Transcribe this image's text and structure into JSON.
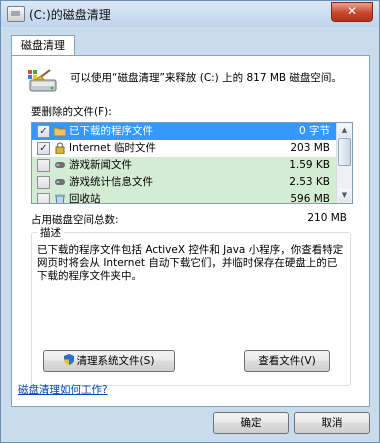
{
  "window": {
    "title": "(C:)的磁盘清理",
    "close_glyph": "✕"
  },
  "tab": {
    "label": "磁盘清理"
  },
  "intro_text": "可以使用“磁盘清理”来释放  (C:) 上的 817 MB 磁盘空间。",
  "files_label": "要删除的文件(F):",
  "files": [
    {
      "name": "已下载的程序文件",
      "size": "0 字节",
      "checked": true,
      "icon": "folder-icon"
    },
    {
      "name": "Internet 临时文件",
      "size": "203 MB",
      "checked": true,
      "icon": "lock-icon"
    },
    {
      "name": "游戏新闻文件",
      "size": "1.59 KB",
      "checked": false,
      "icon": "gamepad-icon"
    },
    {
      "name": "游戏统计信息文件",
      "size": "2.53 KB",
      "checked": false,
      "icon": "gamepad-icon"
    },
    {
      "name": "回收站",
      "size": "596 MB",
      "checked": false,
      "icon": "recycle-bin-icon"
    }
  ],
  "total_label": "占用磁盘空间总数:",
  "total_value": "210 MB",
  "description": {
    "title": "描述",
    "text": "已下载的程序文件包括 ActiveX 控件和 Java 小程序，你查看特定网页时将会从 Internet 自动下载它们，并临时保存在硬盘上的已下载的程序文件夹中。"
  },
  "buttons": {
    "clean_system": "清理系统文件(S)",
    "view_files": "查看文件(V)",
    "ok": "确定",
    "cancel": "取消"
  },
  "help_link": "磁盘清理如何工作?",
  "colors": {
    "selection": "#3399ff",
    "highlight_row": "#d4ecd4",
    "frame": "#c9dcee",
    "link": "#0645ad"
  }
}
